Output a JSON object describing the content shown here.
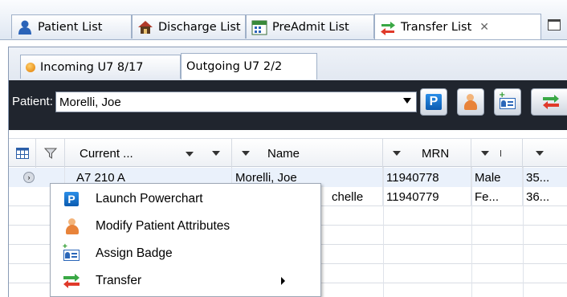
{
  "tabs": [
    {
      "label": "Patient List",
      "icon": "person-icon"
    },
    {
      "label": "Discharge List",
      "icon": "house-icon"
    },
    {
      "label": "PreAdmit List",
      "icon": "calendar-icon"
    },
    {
      "label": "Transfer List",
      "icon": "transfer-arrows-icon",
      "active": true
    }
  ],
  "subtabs": [
    {
      "label": "Incoming U7  8/17"
    },
    {
      "label": "Outgoing U7  2/2",
      "active": true
    }
  ],
  "patient_bar": {
    "label": "Patient:",
    "selected_value": "Morelli, Joe"
  },
  "grid": {
    "headers": {
      "current": "Current ...",
      "name": "Name",
      "mrn": "MRN"
    },
    "rows": [
      {
        "location": "A7 210 A",
        "name": "Morelli, Joe",
        "mrn": "11940778",
        "sex": "Male",
        "age": "35..."
      },
      {
        "location": "",
        "name": "chelle",
        "mrn": "11940779",
        "sex": "Fe...",
        "age": "36..."
      }
    ]
  },
  "context_menu": {
    "items": [
      {
        "label": "Launch Powerchart",
        "icon": "powerchart-icon"
      },
      {
        "label": "Modify Patient Attributes",
        "icon": "person-edit-icon"
      },
      {
        "label": "Assign Badge",
        "icon": "badge-icon"
      },
      {
        "label": "Transfer",
        "icon": "transfer-arrows-icon",
        "has_submenu": true
      }
    ]
  }
}
